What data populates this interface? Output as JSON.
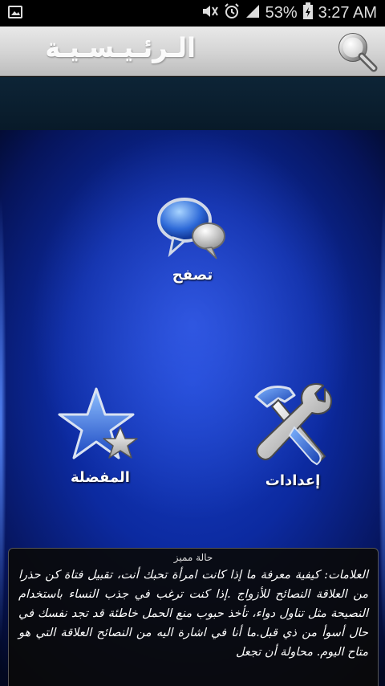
{
  "status_bar": {
    "battery_percent": "53%",
    "time": "3:27 AM",
    "icons": [
      "image-notification-icon",
      "mute-icon",
      "alarm-icon",
      "signal-icon",
      "battery-charging-icon"
    ]
  },
  "header": {
    "title": "الـرئـيـسـيـة",
    "search_icon": "search-icon"
  },
  "main": {
    "tiles": [
      {
        "label": "تصفح",
        "icon": "chat-bubbles-icon"
      },
      {
        "label": "المفضلة",
        "icon": "star-icon"
      },
      {
        "label": "إعدادات",
        "icon": "tools-icon"
      }
    ]
  },
  "status_panel": {
    "title": "حالة مميز",
    "text": "العلامات: كيفية معرفة ما إذا كانت امرأة تحبك أنت، تقبيل فتاة كن حذرا من العلاقة النصائح للأزواج .إذا كنت ترغب في جذب النساء باستخدام النصيحة مثل تناول دواء، تأخذ حبوب منع الحمل خاطئة قد تجد نفسك في حال أسوأ من ذي قبل.ما أنا في اشارة اليه من النصائح العلاقة التي هو متاح اليوم. محاولة أن تجعل"
  },
  "colors": {
    "accent_blue": "#1840c8",
    "header_bg": "#d3d3d3"
  }
}
